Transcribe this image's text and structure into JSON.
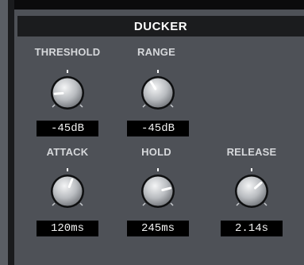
{
  "header": {
    "title": "DUCKER"
  },
  "controls": [
    {
      "label": "THRESHOLD",
      "value": "-45dB",
      "level": 0.15
    },
    {
      "label": "RANGE",
      "value": "-45dB",
      "level": 0.38
    },
    {
      "label": "ATTACK",
      "value": "120ms",
      "level": 0.58
    },
    {
      "label": "HOLD",
      "value": "245ms",
      "level": 0.78
    },
    {
      "label": "RELEASE",
      "value": "2.14s",
      "level": 0.68
    }
  ],
  "colors": {
    "background": "#4e5157",
    "header": "#1b1c1e",
    "label": "#d6d8db"
  }
}
